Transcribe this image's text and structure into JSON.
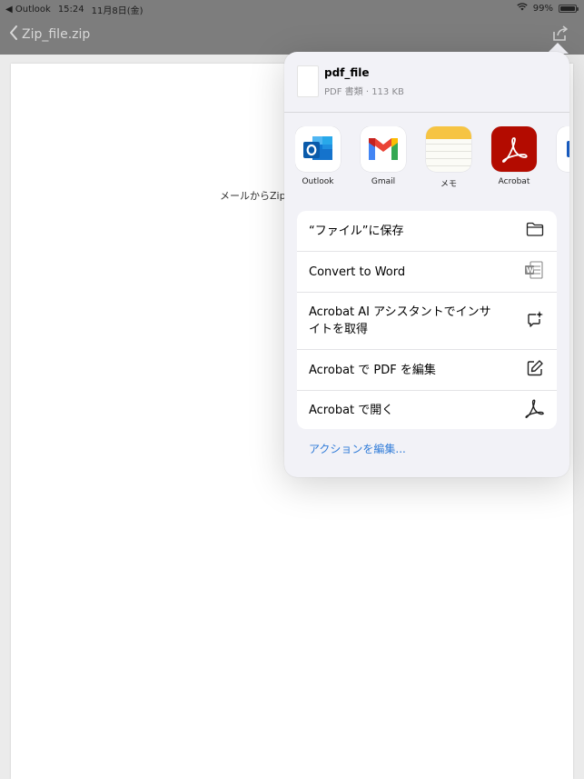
{
  "status_bar": {
    "back_app": "◀ Outlook",
    "time": "15:24",
    "date": "11月8日(金)",
    "battery": "99%"
  },
  "nav": {
    "back_label": "Zip_file.zip"
  },
  "page": {
    "visible_text": "メールからZip"
  },
  "share_sheet": {
    "file": {
      "name": "pdf_file",
      "meta": "PDF 書類 · 113 KB"
    },
    "apps": [
      {
        "label": "Outlook",
        "icon": "outlook-icon"
      },
      {
        "label": "Gmail",
        "icon": "gmail-icon"
      },
      {
        "label": "メモ",
        "icon": "notes-icon"
      },
      {
        "label": "Acrobat",
        "icon": "acrobat-icon"
      },
      {
        "label": "",
        "icon": "word-icon"
      }
    ],
    "actions": [
      {
        "label": "“ファイル”に保存",
        "icon": "folder-icon"
      },
      {
        "label": "Convert to Word",
        "icon": "word-doc-icon"
      },
      {
        "label": "Acrobat AI アシスタントでインサイトを取得",
        "icon": "ai-chat-icon"
      },
      {
        "label": "Acrobat で PDF を編集",
        "icon": "edit-icon"
      },
      {
        "label": "Acrobat で開く",
        "icon": "acrobat-glyph-icon"
      }
    ],
    "edit_actions_label": "アクションを編集...",
    "accent_color": "#2f7bd8"
  }
}
